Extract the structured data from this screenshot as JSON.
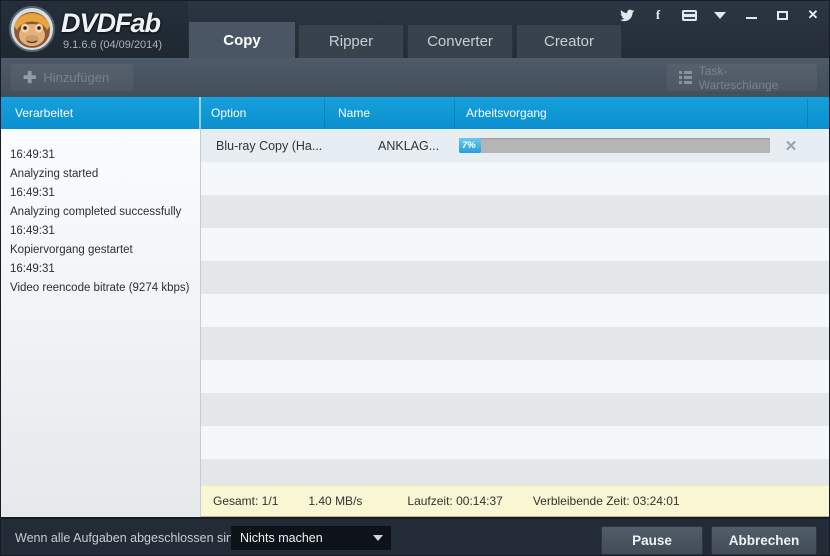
{
  "colors": {
    "accent_blue": "#0d96d5",
    "progress_blue": "#2a9fd9",
    "status_yellow": "#f9f6d4",
    "titlebar_dark": "#232c37",
    "toolbar_slate": "#495562"
  },
  "titlebar": {
    "brand": "DVDFab",
    "version": "9.1.6.6 (04/09/2014)",
    "tabs": [
      {
        "label": "Copy",
        "active": true
      },
      {
        "label": "Ripper",
        "active": false
      },
      {
        "label": "Converter",
        "active": false
      },
      {
        "label": "Creator",
        "active": false
      }
    ],
    "icons": [
      "twitter-icon",
      "facebook-icon",
      "youtube-icon",
      "dropdown-caret-icon",
      "minimize-icon",
      "maximize-icon",
      "close-icon"
    ]
  },
  "toolbar": {
    "add_label": "Hinzufügen",
    "add_icon": "plus-icon",
    "queue_label": "Task-Warteschlange",
    "queue_icon": "task-list-icon"
  },
  "grid_header": {
    "processed": "Verarbeitet",
    "option": "Option",
    "name": "Name",
    "operation": "Arbeitsvorgang"
  },
  "log": {
    "lines": [
      "16:49:31",
      "Analyzing started",
      "16:49:31",
      "Analyzing completed successfully",
      "16:49:31",
      "Kopiervorgang gestartet",
      "16:49:31",
      "Video reencode bitrate (9274 kbps)"
    ]
  },
  "queue": {
    "row": {
      "option": "Blu-ray Copy (Ha...",
      "name": "ANKLAG...",
      "progress_percent": 7,
      "progress_label": "7%",
      "close_icon": "✕"
    }
  },
  "status": {
    "total": "Gesamt: 1/1",
    "speed": "1.40 MB/s",
    "elapsed": "Laufzeit: 00:14:37",
    "remaining": "Verbleibende Zeit: 03:24:01"
  },
  "bottom": {
    "label": "Wenn alle Aufgaben abgeschlossen sind:",
    "dropdown_value": "Nichts machen",
    "pause_label": "Pause",
    "cancel_label": "Abbrechen"
  }
}
